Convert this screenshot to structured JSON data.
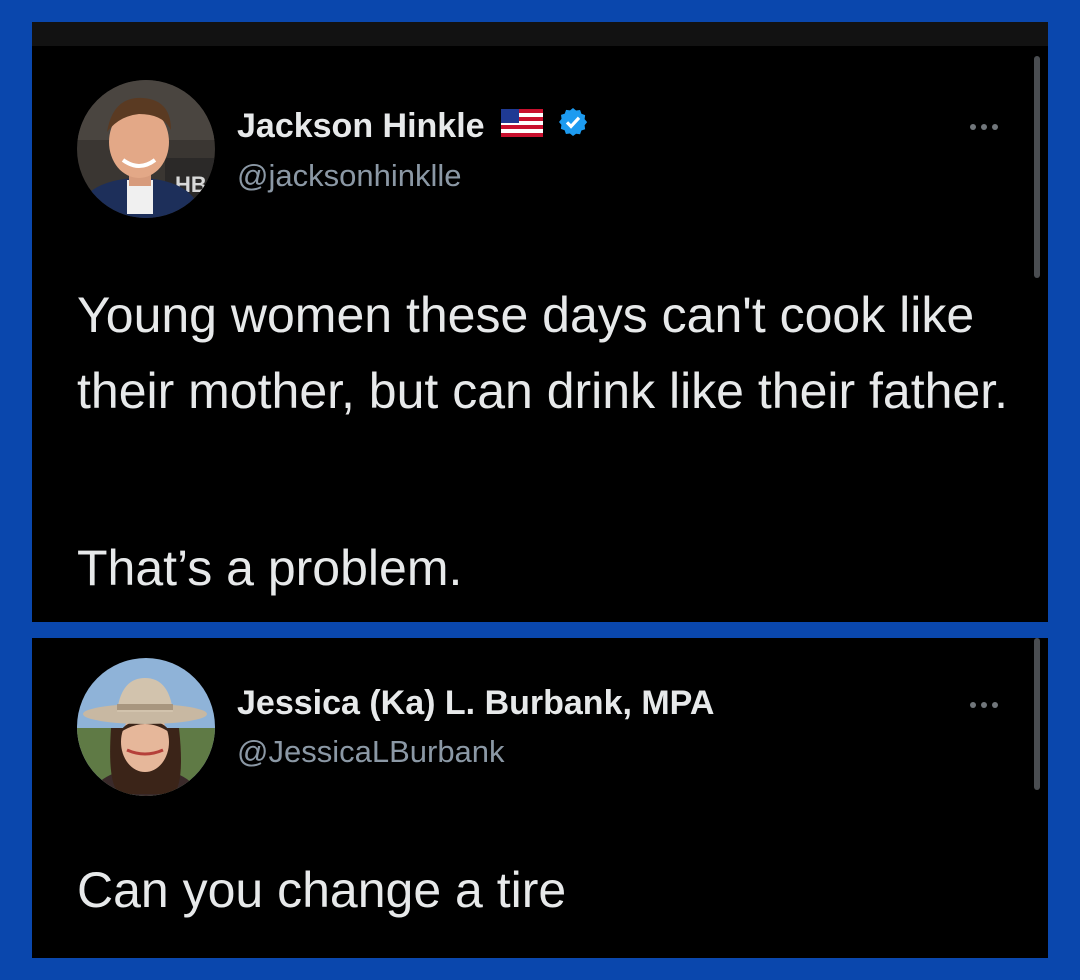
{
  "tweets": [
    {
      "author": {
        "name": "Jackson Hinkle",
        "handle": "@jacksonhinklle",
        "flag_icon": "us-flag-icon",
        "verified_icon": "verified-badge-icon",
        "verified_color": "#1d9bf0"
      },
      "paragraphs": [
        "Young women these days can't cook like their mother, but can drink like their father.",
        "That’s a problem."
      ],
      "more_icon": "more-options-icon"
    },
    {
      "author": {
        "name": "Jessica (Ka) L. Burbank, MPA",
        "handle": "@JessicaLBurbank"
      },
      "paragraphs": [
        "Can you change a tire"
      ],
      "more_icon": "more-options-icon"
    }
  ],
  "colors": {
    "frame_border": "#0a47ad",
    "card_background": "#000000",
    "primary_text": "#e7e9ea",
    "secondary_text": "#8b98a5"
  }
}
